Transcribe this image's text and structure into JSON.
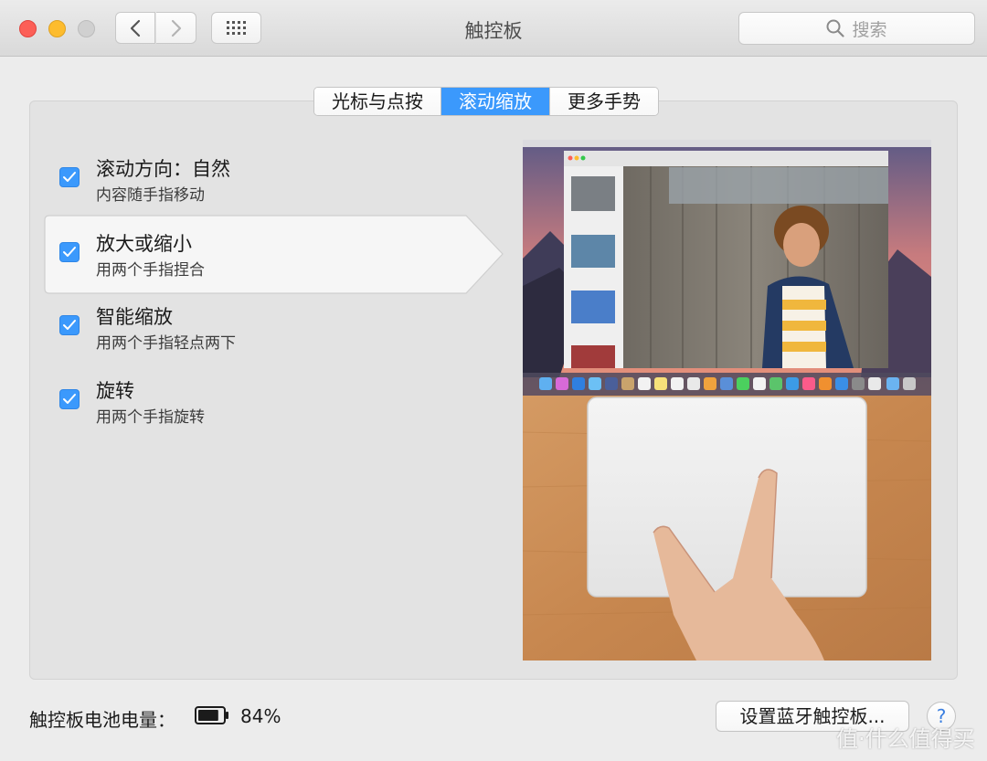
{
  "window": {
    "title": "触控板",
    "search_placeholder": "搜索"
  },
  "tabs": [
    {
      "label": "光标与点按",
      "active": false
    },
    {
      "label": "滚动缩放",
      "active": true
    },
    {
      "label": "更多手势",
      "active": false
    }
  ],
  "options": [
    {
      "title": "滚动方向：自然",
      "subtitle": "内容随手指移动",
      "checked": true
    },
    {
      "title": "放大或缩小",
      "subtitle": "用两个手指捏合",
      "checked": true,
      "selected": true
    },
    {
      "title": "智能缩放",
      "subtitle": "用两个手指轻点两下",
      "checked": true
    },
    {
      "title": "旋转",
      "subtitle": "用两个手指旋转",
      "checked": true
    }
  ],
  "footer": {
    "battery_label": "触控板电池电量：",
    "battery_percent": "84%",
    "battery_level": 0.84,
    "setup_button": "设置蓝牙触控板...",
    "help_button": "?"
  },
  "watermark": "值·什么值得买",
  "colors": {
    "accent": "#3b99fc",
    "close": "#fc5f57",
    "minimize": "#fdbc2e"
  }
}
